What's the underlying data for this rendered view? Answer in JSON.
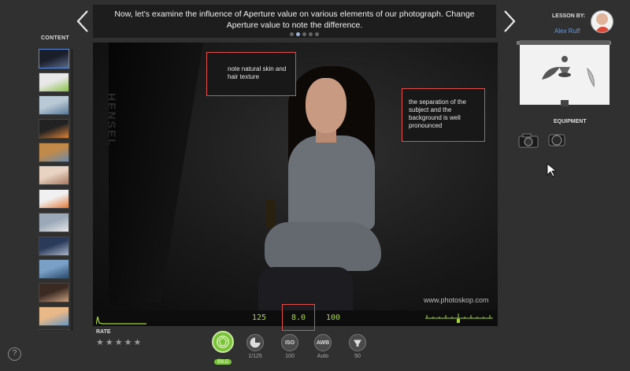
{
  "header": {
    "caption": "Now, let's examine the influence of Aperture value on various elements of our photograph. Change Aperture value to note the difference.",
    "slide_dots": 5,
    "active_dot": 1
  },
  "sidebar": {
    "content_label": "CONTENT",
    "thumbnails": [
      {
        "name": "portrait-woman",
        "colors": [
          "#1a1d2a",
          "#5b6b8a"
        ]
      },
      {
        "name": "green-apples",
        "colors": [
          "#e8e8e8",
          "#8bc34a"
        ]
      },
      {
        "name": "beach-figure",
        "colors": [
          "#b9c9d6",
          "#5a7a96"
        ]
      },
      {
        "name": "vinyl-record",
        "colors": [
          "#222",
          "#d8823a"
        ]
      },
      {
        "name": "autumn-lake",
        "colors": [
          "#c08a4a",
          "#6c8aa8"
        ]
      },
      {
        "name": "woman-portrait",
        "colors": [
          "#e8d2c2",
          "#a87a62"
        ]
      },
      {
        "name": "pencils",
        "colors": [
          "#f0f0f0",
          "#e07a3a"
        ]
      },
      {
        "name": "city-skyline",
        "colors": [
          "#9aa8b8",
          "#e8e8e8"
        ]
      },
      {
        "name": "city-night",
        "colors": [
          "#2a3a5a",
          "#a8b4c8"
        ]
      },
      {
        "name": "mountain-lake",
        "colors": [
          "#7aa0c8",
          "#2a4a6a"
        ]
      },
      {
        "name": "man-desk",
        "colors": [
          "#3a2a22",
          "#c8a080"
        ]
      },
      {
        "name": "sea-sunset",
        "colors": [
          "#e8b888",
          "#6a98c0"
        ]
      },
      {
        "name": "man-portrait",
        "colors": [
          "#2a2520",
          "#b89878"
        ]
      }
    ]
  },
  "photo": {
    "annotation_1": "note natural skin and hair texture",
    "annotation_2": "the separation of the subject and the background is well pronounced",
    "watermark": "www.photoskop.com",
    "softbox_brand": "HENSEL"
  },
  "readout": {
    "shutter": "125",
    "aperture": "8.0",
    "iso": "100",
    "color": "#a6d83a"
  },
  "rate": {
    "label": "RATE",
    "stars": 5
  },
  "controls": {
    "aperture": {
      "label": "f/8.0",
      "icon": "aperture-icon"
    },
    "shutter": {
      "label": "1/125",
      "icon": "shutter-icon"
    },
    "iso": {
      "label": "100",
      "icon_text": "ISO"
    },
    "wb": {
      "label": "Auto",
      "icon_text": "AWB"
    },
    "focal": {
      "label": "50",
      "icon": "lens-icon"
    }
  },
  "lesson": {
    "label": "LESSON BY:",
    "author": "Alex Ruff"
  },
  "equipment": {
    "label": "EQUIPMENT"
  },
  "colors": {
    "accent": "#7ac23c",
    "highlight": "#e04d4d",
    "link": "#6e99d6"
  }
}
